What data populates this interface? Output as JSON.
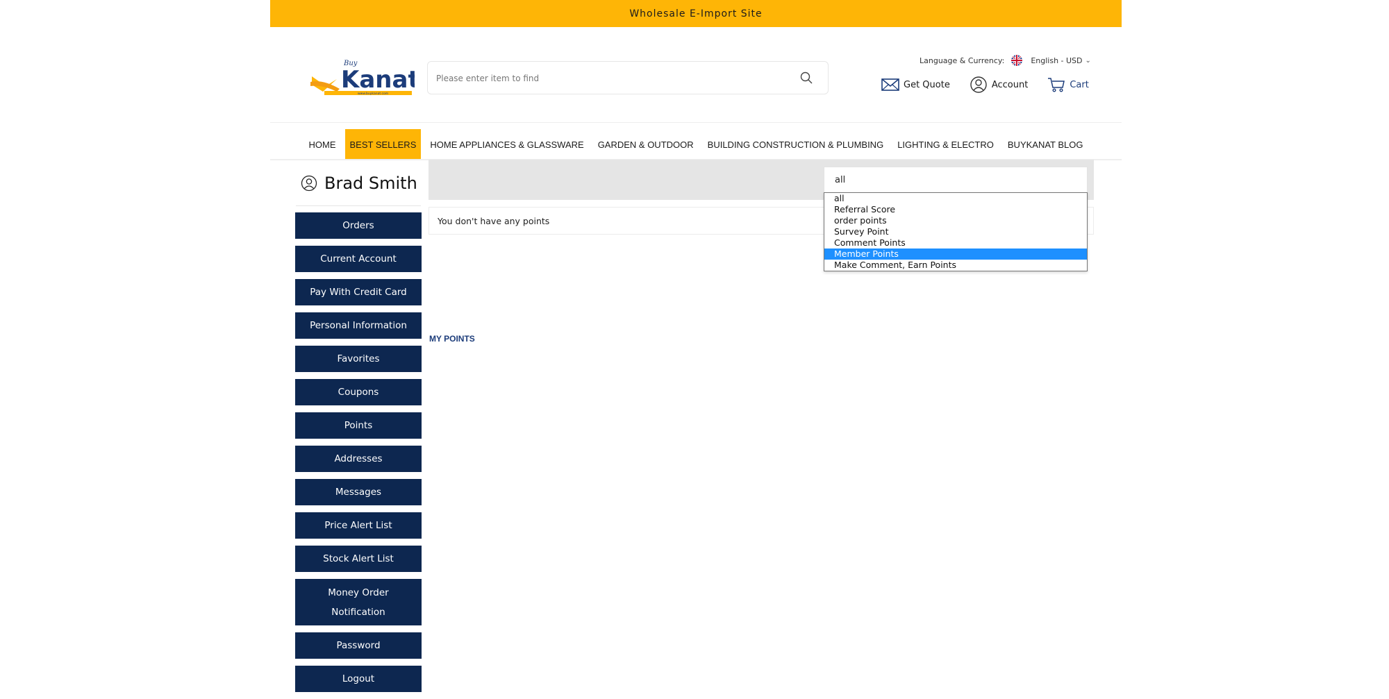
{
  "banner": {
    "text": "Wholesale E-Import Site"
  },
  "header": {
    "search": {
      "placeholder": "Please enter item to find"
    },
    "language": {
      "label": "Language & Currency:",
      "value": "English - USD"
    },
    "links": {
      "quote": "Get Quote",
      "account": "Account",
      "cart": "Cart"
    }
  },
  "nav": {
    "items": [
      {
        "label": "HOME"
      },
      {
        "label": "BEST SELLERS"
      },
      {
        "label": "HOME APPLIANCES & GLASSWARE"
      },
      {
        "label": "GARDEN & OUTDOOR"
      },
      {
        "label": "BUILDING CONSTRUCTION & PLUMBING"
      },
      {
        "label": "LIGHTING & ELECTRO"
      },
      {
        "label": "BUYKANAT BLOG"
      }
    ],
    "active_index": 1
  },
  "sidebar": {
    "user_name": "Brad Smith",
    "items": [
      {
        "label": "Orders"
      },
      {
        "label": "Current Account"
      },
      {
        "label": "Pay With Credit Card"
      },
      {
        "label": "Personal Information"
      },
      {
        "label": "Favorites"
      },
      {
        "label": "Coupons"
      },
      {
        "label": "Points"
      },
      {
        "label": "Addresses"
      },
      {
        "label": "Messages"
      },
      {
        "label": "Price Alert List"
      },
      {
        "label": "Stock Alert List"
      },
      {
        "label": "Money Order Notification"
      },
      {
        "label": "Password"
      },
      {
        "label": "Logout"
      }
    ]
  },
  "main": {
    "title": "MY POINTS",
    "empty_message": "You don't have any points",
    "filter": {
      "current_value": "all",
      "options": [
        {
          "label": "all"
        },
        {
          "label": "Referral Score"
        },
        {
          "label": "order points"
        },
        {
          "label": "Survey Point"
        },
        {
          "label": "Comment Points"
        },
        {
          "label": "Member Points"
        },
        {
          "label": "Make Comment, Earn Points"
        }
      ],
      "highlighted_index": 5
    }
  },
  "colors": {
    "brand_yellow": "#feb506",
    "brand_navy": "#0d2750",
    "link_blue": "#1c3c7a",
    "highlight": "#1e90ff"
  }
}
